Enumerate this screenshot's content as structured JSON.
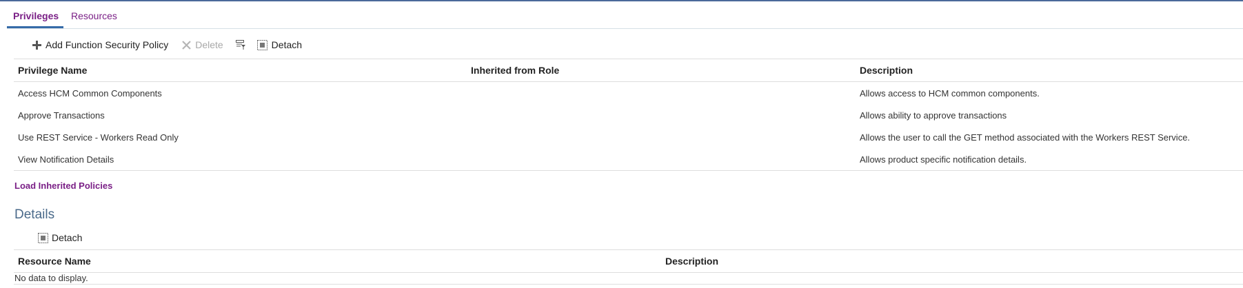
{
  "tabs": {
    "privileges": "Privileges",
    "resources": "Resources"
  },
  "toolbar": {
    "add_label": "Add Function Security Policy",
    "delete_label": "Delete",
    "detach_label": "Detach"
  },
  "privileges_table": {
    "headers": [
      "Privilege Name",
      "Inherited from Role",
      "Description"
    ],
    "rows": [
      {
        "name": "Access HCM Common Components",
        "inherited": "",
        "description": "Allows access to HCM common components."
      },
      {
        "name": "Approve Transactions",
        "inherited": "",
        "description": "Allows ability to approve transactions"
      },
      {
        "name": "Use REST Service - Workers Read Only",
        "inherited": "",
        "description": "Allows the user to call the GET method associated with the Workers REST Service."
      },
      {
        "name": "View Notification Details",
        "inherited": "",
        "description": "Allows product specific notification details."
      }
    ]
  },
  "load_inherited_link": "Load Inherited Policies",
  "details": {
    "title": "Details",
    "detach_label": "Detach",
    "headers": [
      "Resource Name",
      "Description"
    ],
    "empty_text": "No data to display."
  },
  "icons": {
    "add": "plus-icon",
    "delete": "x-icon",
    "filter": "query-by-example-icon",
    "detach": "detach-icon"
  },
  "colors": {
    "link": "#7a1f86",
    "tab_underline": "#356ba8",
    "details_title": "#4a6a8a"
  }
}
